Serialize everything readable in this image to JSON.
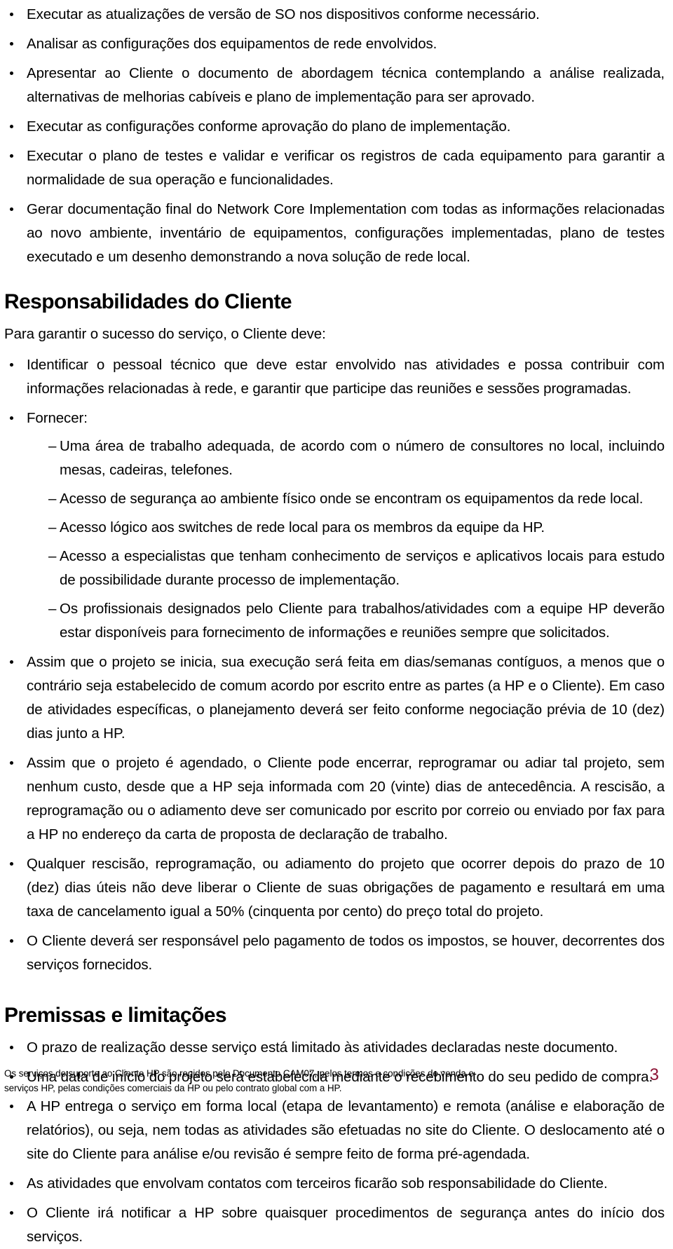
{
  "document": {
    "page_number": "3",
    "footer_note": "Os serviços de suporte ao Cliente HP são regidos pelo Documento CAM07, pelos termos e condições de venda e serviços HP, pelas condições comerciais da HP ou pelo contrato global com a HP."
  },
  "top_bullets": [
    "Executar as atualizações de versão de SO nos dispositivos conforme necessário.",
    "Analisar as configurações dos equipamentos de rede envolvidos.",
    "Apresentar ao Cliente o documento de abordagem técnica contemplando a análise realizada, alternativas de melhorias cabíveis e plano de implementação para ser aprovado.",
    "Executar as configurações conforme aprovação do plano de implementação.",
    "Executar o plano de testes e validar e verificar os registros de cada equipamento para garantir a normalidade de sua operação e funcionalidades.",
    "Gerar documentação final do Network Core Implementation com todas as informações relacionadas ao novo ambiente, inventário de equipamentos, configurações implementadas, plano de testes executado e um desenho demonstrando a nova solução de rede local."
  ],
  "section_responsabilidades": {
    "heading": "Responsabilidades do Cliente",
    "intro": "Para garantir o sucesso do serviço, o Cliente deve:",
    "bullet_1": "Identificar o pessoal técnico que deve estar envolvido nas atividades e possa contribuir com informações relacionadas à rede, e garantir que participe das reuniões e sessões programadas.",
    "bullet_2": "Fornecer:",
    "sub_items": [
      "Uma área de trabalho adequada, de acordo com o número de consultores no local, incluindo mesas, cadeiras, telefones.",
      "Acesso de segurança ao ambiente físico onde se encontram os equipamentos da rede local.",
      "Acesso lógico aos switches de rede local para os membros da equipe da HP.",
      "Acesso a especialistas que tenham conhecimento de serviços e aplicativos locais para estudo de possibilidade durante processo de implementação.",
      "Os profissionais designados pelo Cliente para trabalhos/atividades com a equipe HP deverão estar disponíveis para fornecimento de informações e reuniões sempre que solicitados."
    ],
    "bullets_after": [
      "Assim que o projeto se inicia, sua execução será feita em dias/semanas contíguos, a menos que o contrário seja estabelecido de comum acordo por escrito entre as partes (a HP e o Cliente). Em caso de atividades específicas, o planejamento deverá ser feito conforme negociação prévia de 10 (dez) dias junto a HP.",
      "Assim que o projeto é agendado, o Cliente pode encerrar, reprogramar ou adiar tal projeto, sem nenhum custo, desde que a HP seja informada com 20 (vinte) dias de antecedência. A rescisão, a reprogramação ou o adiamento deve ser comunicado por escrito por correio ou enviado por fax para a HP no endereço da carta de proposta de declaração de trabalho.",
      "Qualquer rescisão, reprogramação, ou adiamento do projeto que ocorrer depois do prazo de 10 (dez) dias úteis não deve liberar o Cliente de suas obrigações de pagamento e resultará em uma taxa de cancelamento igual a 50% (cinquenta por cento) do preço total do projeto.",
      "O Cliente deverá ser responsável pelo pagamento de todos os impostos, se houver, decorrentes dos serviços fornecidos."
    ]
  },
  "section_premissas": {
    "heading": "Premissas e limitações",
    "bullets": [
      "O prazo de realização desse serviço está limitado às atividades declaradas neste documento.",
      "Uma data de início do projeto será estabelecida mediante o recebimento do seu pedido de compra.",
      "A HP entrega o serviço em forma local (etapa de levantamento) e remota (análise e elaboração de relatórios), ou seja, nem todas as atividades são efetuadas no site do Cliente. O deslocamento até o site do Cliente para análise e/ou revisão é sempre feito de forma pré-agendada.",
      "As atividades que envolvam contatos com terceiros ficarão sob responsabilidade do Cliente.",
      "O Cliente irá notificar a HP sobre quaisquer procedimentos de segurança antes do início dos serviços."
    ]
  }
}
